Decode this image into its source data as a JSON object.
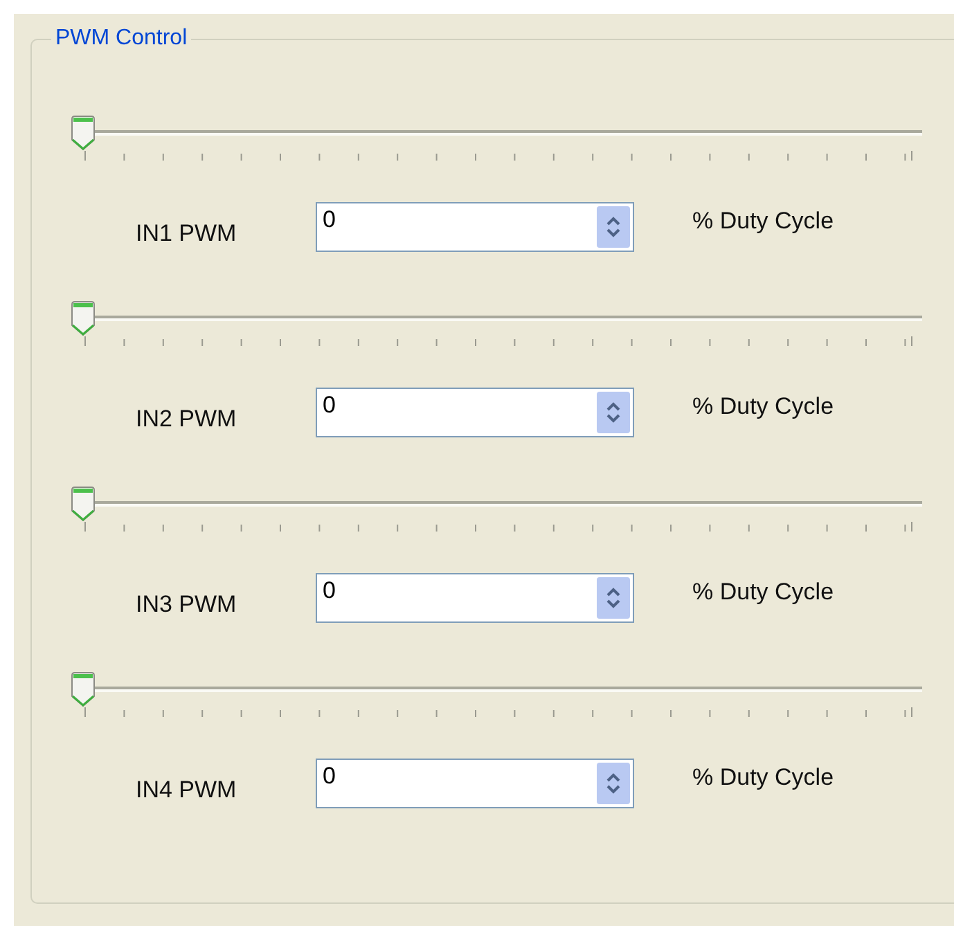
{
  "group": {
    "title": "PWM Control"
  },
  "channels": [
    {
      "label": "IN1 PWM",
      "value": "0",
      "unit": "% Duty Cycle",
      "level": 0
    },
    {
      "label": "IN2 PWM",
      "value": "0",
      "unit": "% Duty Cycle",
      "level": 0
    },
    {
      "label": "IN3 PWM",
      "value": "0",
      "unit": "% Duty Cycle",
      "level": 0
    },
    {
      "label": "IN4 PWM",
      "value": "0",
      "unit": "% Duty Cycle",
      "level": 0
    }
  ]
}
